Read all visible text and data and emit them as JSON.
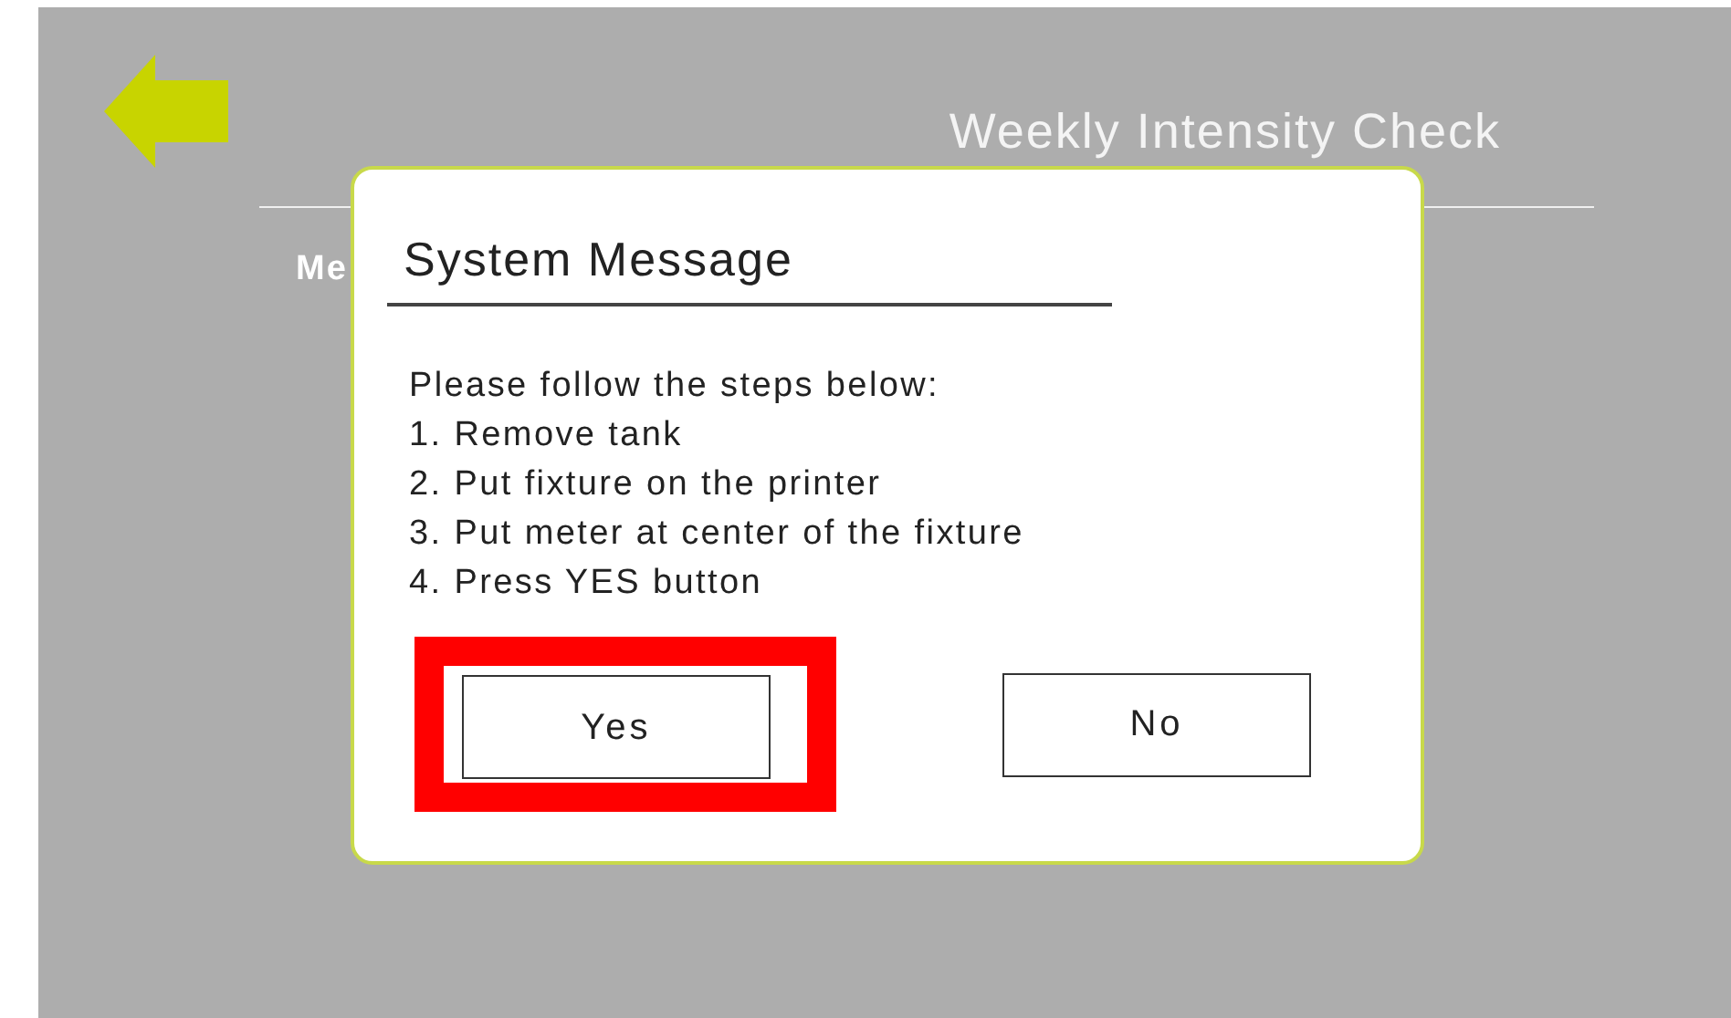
{
  "header": {
    "title": "Weekly Intensity Check"
  },
  "background_label": "Me",
  "dialog": {
    "title": "System Message",
    "lines": [
      "Please follow the steps below:",
      "1. Remove tank",
      "2. Put fixture on the printer",
      "3. Put meter at center of the fixture",
      "4. Press YES button"
    ],
    "buttons": [
      {
        "label": "Yes",
        "highlighted": true
      },
      {
        "label": "No",
        "highlighted": false
      }
    ]
  }
}
